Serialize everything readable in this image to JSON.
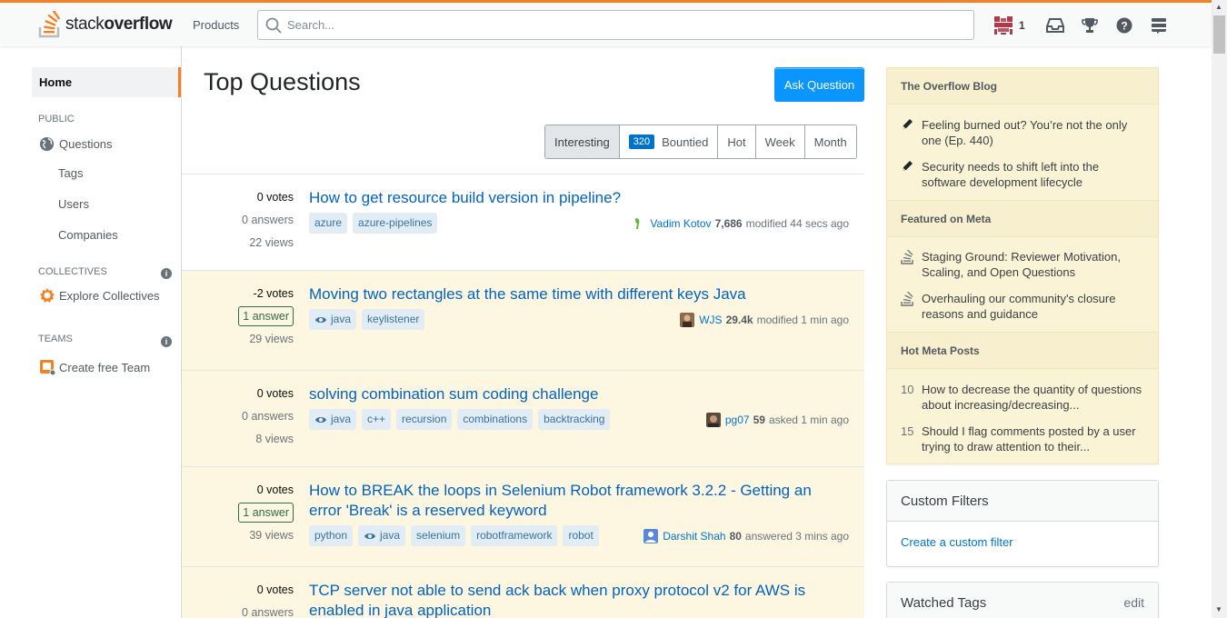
{
  "header": {
    "logo_light": "stack",
    "logo_bold": "overflow",
    "products": "Products",
    "search_placeholder": "Search...",
    "reputation": "1"
  },
  "colors": {
    "accent": "#f48225",
    "link": "#0074cc",
    "primary_button": "#0a95ff",
    "highlight_row": "#fdf7e2",
    "blog_bg": "#fbf3d5"
  },
  "sidebar": {
    "home": "Home",
    "public": "PUBLIC",
    "questions": "Questions",
    "tags": "Tags",
    "users": "Users",
    "companies": "Companies",
    "collectives": "COLLECTIVES",
    "explore_collectives": "Explore Collectives",
    "teams": "TEAMS",
    "create_team": "Create free Team"
  },
  "main": {
    "title": "Top Questions",
    "ask": "Ask Question",
    "filters": [
      "Interesting",
      "Bountied",
      "Hot",
      "Week",
      "Month"
    ],
    "bounty_count": "320"
  },
  "questions": [
    {
      "votes": "0 votes",
      "answers": "0 answers",
      "answered": false,
      "views": "22 views",
      "title": "How to get resource build version in pipeline?",
      "tags": [
        "azure",
        "azure-pipelines"
      ],
      "watched": [],
      "user": "Vadim Kotov",
      "rep": "7,686",
      "action": "modified 44 secs ago"
    },
    {
      "votes": "-2 votes",
      "answers": "1 answer",
      "answered": true,
      "views": "29 views",
      "title": "Moving two rectangles at the same time with different keys Java",
      "tags": [
        "java",
        "keylistener"
      ],
      "watched": [
        "java"
      ],
      "user": "WJS",
      "rep": "29.4k",
      "action": "modified 1 min ago"
    },
    {
      "votes": "0 votes",
      "answers": "0 answers",
      "answered": false,
      "views": "8 views",
      "title": "solving combination sum coding challenge",
      "tags": [
        "java",
        "c++",
        "recursion",
        "combinations",
        "backtracking"
      ],
      "watched": [
        "java"
      ],
      "user": "pg07",
      "rep": "59",
      "action": "asked 1 min ago"
    },
    {
      "votes": "0 votes",
      "answers": "1 answer",
      "answered": true,
      "views": "39 views",
      "title_line1": "How to BREAK the loops in Selenium Robot framework 3.2.2 - Getting an",
      "title_line2": "error 'Break' is a reserved keyword",
      "tags": [
        "python",
        "java",
        "selenium",
        "robotframework",
        "robot"
      ],
      "watched": [
        "java"
      ],
      "user": "Darshit Shah",
      "rep": "80",
      "action": "answered 3 mins ago"
    },
    {
      "votes": "0 votes",
      "answers": "0 answers",
      "answered": false,
      "title_line1": "TCP server not able to send ack back when proxy protocol v2 for AWS is",
      "title_line2": "enabled in java application"
    }
  ],
  "right": {
    "blog_title": "The Overflow Blog",
    "blog_items": [
      [
        "Feeling burned out? You’re not the only",
        "one (Ep. 440)"
      ],
      [
        "Security needs to shift left into the",
        "software development lifecycle"
      ]
    ],
    "meta_title": "Featured on Meta",
    "meta_items": [
      [
        "Staging Ground: Reviewer Motivation,",
        "Scaling, and Open Questions"
      ],
      [
        "Overhauling our community's closure",
        "reasons and guidance"
      ]
    ],
    "hot_title": "Hot Meta Posts",
    "hot_items": [
      {
        "num": "10",
        "l1": "How to decrease the quantity of questions",
        "l2": "about increasing/decreasing..."
      },
      {
        "num": "15",
        "l1": "Should I flag comments posted by a user",
        "l2": "trying to draw attention to their..."
      }
    ],
    "custom_filters": "Custom Filters",
    "create_filter": "Create a custom filter",
    "watched_tags": "Watched Tags",
    "edit": "edit"
  }
}
